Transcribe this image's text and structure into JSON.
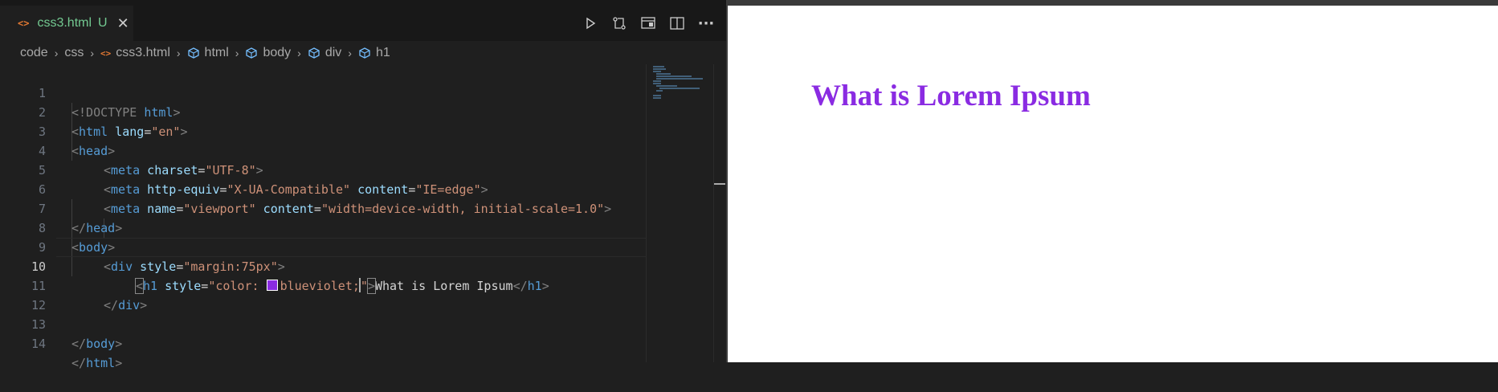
{
  "tab": {
    "file_icon": "<>",
    "name": "css3.html",
    "status": "U",
    "close": "✕"
  },
  "toolbar": {
    "icons": [
      "run-icon",
      "compare-changes-icon",
      "open-preview-icon",
      "split-editor-icon",
      "more-actions-icon"
    ],
    "more": "···"
  },
  "breadcrumb": {
    "items": [
      "code",
      "css",
      "css3.html",
      "html",
      "body",
      "div",
      "h1"
    ]
  },
  "code": {
    "line_numbers": [
      "1",
      "2",
      "3",
      "4",
      "5",
      "6",
      "7",
      "8",
      "9",
      "10",
      "11",
      "12",
      "13",
      "14"
    ],
    "current_line": "10",
    "l1": {
      "open": "<!DOCTYPE ",
      "kw": "html",
      "close": ">"
    },
    "l2": {
      "open": "<",
      "tag": "html",
      "attr": " lang",
      "eq": "=",
      "val": "\"en\"",
      "close": ">"
    },
    "l3": {
      "open": "<",
      "tag": "head",
      "close": ">"
    },
    "l4": {
      "open": "<",
      "tag": "meta",
      "attr": " charset",
      "eq": "=",
      "val": "\"UTF-8\"",
      "close": ">"
    },
    "l5": {
      "open": "<",
      "tag": "meta",
      "attr1": " http-equiv",
      "eq1": "=",
      "val1": "\"X-UA-Compatible\"",
      "attr2": " content",
      "eq2": "=",
      "val2": "\"IE=edge\"",
      "close": ">"
    },
    "l6": {
      "open": "<",
      "tag": "meta",
      "attr1": " name",
      "eq1": "=",
      "val1": "\"viewport\"",
      "attr2": " content",
      "eq2": "=",
      "val2": "\"width=device-width, initial-scale=1.0\"",
      "close": ">"
    },
    "l7": {
      "open": "</",
      "tag": "head",
      "close": ">"
    },
    "l8": {
      "open": "<",
      "tag": "body",
      "close": ">"
    },
    "l9": {
      "open": "<",
      "tag": "div",
      "attr": " style",
      "eq": "=",
      "val": "\"margin:75px\"",
      "close": ">"
    },
    "l10": {
      "open": "<",
      "tag": "h1",
      "attr": " style",
      "eq": "=",
      "val_a": "\"color: ",
      "val_b": "blueviolet",
      "val_c": ";",
      "val_d": "\"",
      "close": ">",
      "text": "What is Lorem Ipsum",
      "end_open": "</",
      "end_tag": "h1",
      "end_close": ">"
    },
    "l11": {
      "open": "</",
      "tag": "div",
      "close": ">"
    },
    "l13": {
      "open": "</",
      "tag": "body",
      "close": ">"
    },
    "l14": {
      "open": "</",
      "tag": "html",
      "close": ">"
    }
  },
  "preview": {
    "heading": "What is Lorem Ipsum"
  },
  "colors": {
    "heading": "#8a2be2",
    "swatch": "#8a2be2",
    "tab_modified": "#73c991"
  }
}
